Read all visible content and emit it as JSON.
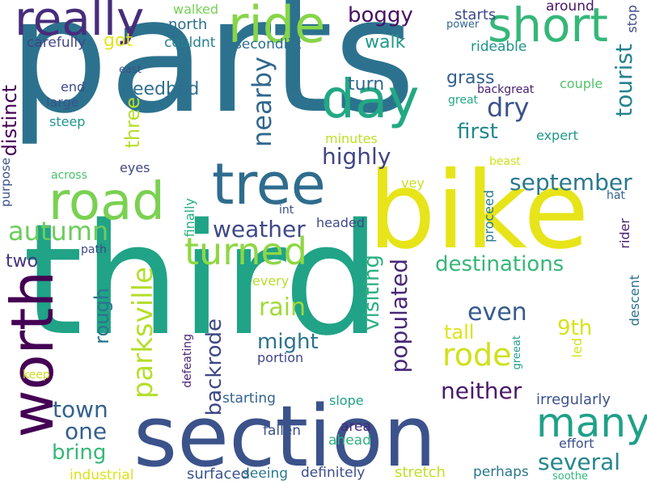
{
  "word_cloud": {
    "words": [
      {
        "text": "parts",
        "color": "#2c728e"
      },
      {
        "text": "third",
        "color": "#20a386"
      },
      {
        "text": "section",
        "color": "#3b528b"
      },
      {
        "text": "bike",
        "color": "#e7e419"
      },
      {
        "text": "worth",
        "color": "#440154"
      },
      {
        "text": "road",
        "color": "#7ad151"
      },
      {
        "text": "tree",
        "color": "#2f6c8e"
      },
      {
        "text": "really",
        "color": "#472d7b"
      },
      {
        "text": "ride",
        "color": "#86d549"
      },
      {
        "text": "day",
        "color": "#22a884"
      },
      {
        "text": "short",
        "color": "#35b779"
      },
      {
        "text": "many",
        "color": "#1fa188"
      },
      {
        "text": "turned",
        "color": "#8fd744"
      },
      {
        "text": "parksville",
        "color": "#b5de2b"
      },
      {
        "text": "nearby",
        "color": "#31688e"
      },
      {
        "text": "autumn",
        "color": "#6ccd5a"
      },
      {
        "text": "tourist",
        "color": "#26828e"
      },
      {
        "text": "weather",
        "color": "#3e4989"
      },
      {
        "text": "september",
        "color": "#29798e"
      },
      {
        "text": "populated",
        "color": "#482878"
      },
      {
        "text": "visiting",
        "color": "#2ab07f"
      },
      {
        "text": "rode",
        "color": "#d0e11c"
      },
      {
        "text": "neither",
        "color": "#481a6c"
      },
      {
        "text": "several",
        "color": "#24868e"
      },
      {
        "text": "destinations",
        "color": "#35b779"
      },
      {
        "text": "highly",
        "color": "#414487"
      },
      {
        "text": "first",
        "color": "#23898e"
      },
      {
        "text": "dry",
        "color": "#3b528b"
      },
      {
        "text": "even",
        "color": "#365c8d"
      },
      {
        "text": "rain",
        "color": "#a0da39"
      },
      {
        "text": "might",
        "color": "#2c728e"
      },
      {
        "text": "backrode",
        "color": "#3f4788"
      },
      {
        "text": "town",
        "color": "#33638d"
      },
      {
        "text": "one",
        "color": "#355f8d"
      },
      {
        "text": "bring",
        "color": "#37b878"
      },
      {
        "text": "boggy",
        "color": "#471164"
      },
      {
        "text": "walk",
        "color": "#1f9a8a"
      },
      {
        "text": "grass",
        "color": "#34608d"
      },
      {
        "text": "turn",
        "color": "#31688e"
      },
      {
        "text": "three",
        "color": "#b8de29"
      },
      {
        "text": "needbad",
        "color": "#2e6f8e"
      },
      {
        "text": "distinct",
        "color": "#440154"
      },
      {
        "text": "rough",
        "color": "#2b748e"
      },
      {
        "text": "tall",
        "color": "#dfe318"
      },
      {
        "text": "9th",
        "color": "#d8e219"
      },
      {
        "text": "got",
        "color": "#e5e419"
      },
      {
        "text": "two",
        "color": "#46337f"
      },
      {
        "text": "starts",
        "color": "#3e4989"
      },
      {
        "text": "north",
        "color": "#2e6e8e"
      },
      {
        "text": "couldnt",
        "color": "#277f8e"
      },
      {
        "text": "carefully",
        "color": "#404688"
      },
      {
        "text": "walked",
        "color": "#75d054"
      },
      {
        "text": "around",
        "color": "#481668"
      },
      {
        "text": "secondlift",
        "color": "#2e6f8e"
      },
      {
        "text": "rideable",
        "color": "#21918c"
      },
      {
        "text": "irregularly",
        "color": "#3b528b"
      },
      {
        "text": "surfaced",
        "color": "#3a548c"
      },
      {
        "text": "stretch",
        "color": "#c2df23"
      },
      {
        "text": "definitely",
        "color": "#3e4c8a"
      },
      {
        "text": "seeing",
        "color": "#2a788e"
      },
      {
        "text": "perhaps",
        "color": "#2a778e"
      },
      {
        "text": "industrial",
        "color": "#dde318"
      },
      {
        "text": "starting",
        "color": "#33638d"
      },
      {
        "text": "fallen",
        "color": "#3b528b"
      },
      {
        "text": "area",
        "color": "#482878"
      },
      {
        "text": "ahead",
        "color": "#2db27d"
      },
      {
        "text": "slope",
        "color": "#20a386"
      },
      {
        "text": "portion",
        "color": "#3f4788"
      },
      {
        "text": "every",
        "color": "#b5de2b"
      },
      {
        "text": "minutes",
        "color": "#bddf26"
      },
      {
        "text": "proceed",
        "color": "#297b8e"
      },
      {
        "text": "headed",
        "color": "#3e4989"
      },
      {
        "text": "int",
        "color": "#3d4e8a"
      },
      {
        "text": "finally",
        "color": "#29af7f"
      },
      {
        "text": "vey",
        "color": "#c8e020"
      },
      {
        "text": "expert",
        "color": "#1f988b"
      },
      {
        "text": "couple",
        "color": "#50c46a"
      },
      {
        "text": "backgreat",
        "color": "#482173"
      },
      {
        "text": "great",
        "color": "#22a785"
      },
      {
        "text": "beast",
        "color": "#d2e21b"
      },
      {
        "text": "hat",
        "color": "#34618d"
      },
      {
        "text": "rider",
        "color": "#481f70"
      },
      {
        "text": "descent",
        "color": "#2c718e"
      },
      {
        "text": "led",
        "color": "#d5e21a"
      },
      {
        "text": "greeat",
        "color": "#1f9e89"
      },
      {
        "text": "effort",
        "color": "#3b528b"
      },
      {
        "text": "soothe",
        "color": "#35b779"
      },
      {
        "text": "power",
        "color": "#31688e"
      },
      {
        "text": "stop",
        "color": "#3e4a89"
      },
      {
        "text": "east",
        "color": "#3b528b"
      },
      {
        "text": "end",
        "color": "#3e4989"
      },
      {
        "text": "large",
        "color": "#3b528b"
      },
      {
        "text": "steep",
        "color": "#1f958b"
      },
      {
        "text": "eyes",
        "color": "#3f4788"
      },
      {
        "text": "across",
        "color": "#48c16e"
      },
      {
        "text": "purpose",
        "color": "#3b528b"
      },
      {
        "text": "path",
        "color": "#3e4989"
      },
      {
        "text": "keep",
        "color": "#cae11f"
      },
      {
        "text": "defeating",
        "color": "#482475"
      }
    ]
  }
}
